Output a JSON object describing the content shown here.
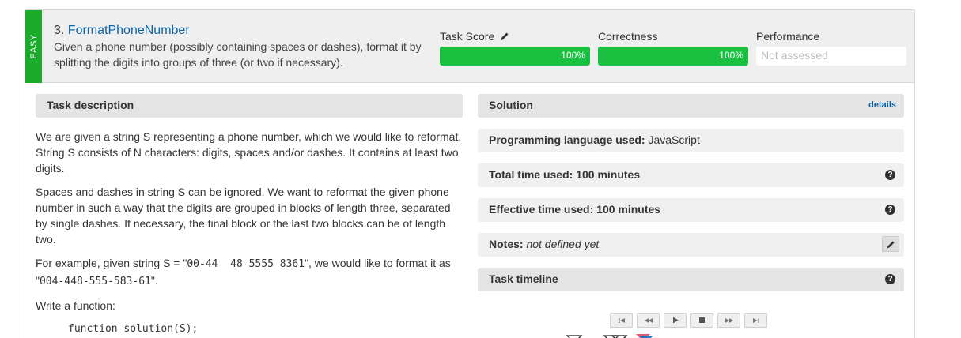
{
  "task": {
    "difficulty": "EASY",
    "number": "3.",
    "name": "FormatPhoneNumber",
    "summary": "Given a phone number (possibly containing spaces or dashes), format it by splitting the digits into groups of three (or two if necessary)."
  },
  "metrics": {
    "task_score": {
      "label": "Task Score",
      "value": "100%",
      "fraction": 1.0
    },
    "correctness": {
      "label": "Correctness",
      "value": "100%",
      "fraction": 1.0
    },
    "performance": {
      "label": "Performance",
      "value": "Not assessed"
    }
  },
  "description": {
    "heading": "Task description",
    "p1": "We are given a string S representing a phone number, which we would like to reformat. String S consists of N characters: digits, spaces and/or dashes. It contains at least two digits.",
    "p2": "Spaces and dashes in string S can be ignored. We want to reformat the given phone number in such a way that the digits are grouped in blocks of length three, separated by single dashes. If necessary, the final block or the last two blocks can be of length two.",
    "p3_prefix": "For example, given string S = \"",
    "p3_code1": "00-44  48 5555 8361",
    "p3_mid": "\", we would like to format it as \"",
    "p3_code2": "004-448-555-583-61",
    "p3_suffix": "\".",
    "p4": "Write a function:",
    "code": "function solution(S);"
  },
  "solution": {
    "heading": "Solution",
    "details_link": "details",
    "language_label": "Programming language used:",
    "language_value": "JavaScript",
    "total_time": "Total time used: 100 minutes",
    "effective_time": "Effective time used: 100 minutes",
    "notes_label": "Notes:",
    "notes_value": "not defined yet",
    "timeline_heading": "Task timeline"
  },
  "player_buttons": [
    "first",
    "prev",
    "play",
    "stop",
    "next",
    "last"
  ],
  "colors": {
    "easy": "#1bac2b",
    "progress": "#1ac040",
    "link": "#0b63a8"
  }
}
